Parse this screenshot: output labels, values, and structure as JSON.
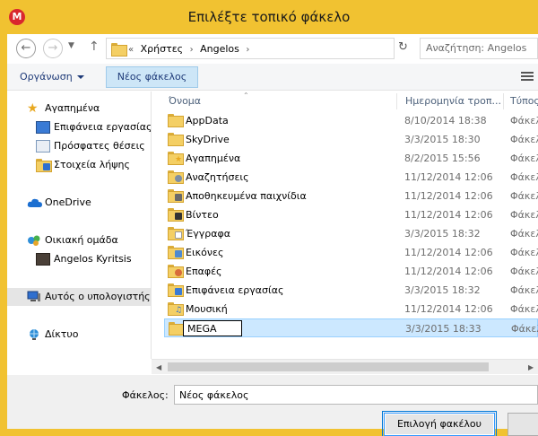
{
  "window": {
    "title": "Επιλέξτε τοπικό φάκελο",
    "app_icon_letter": "M",
    "accent": "#f1c231"
  },
  "nav": {
    "back_icon": "back-arrow-icon",
    "forward_icon": "forward-arrow-icon",
    "breadcrumb_prefix": "«",
    "breadcrumbs": [
      "Χρήστες",
      "Angelos"
    ],
    "search_placeholder": "Αναζήτηση: Angelos"
  },
  "toolbar": {
    "organize_label": "Οργάνωση",
    "new_folder_label": "Νέος φάκελος"
  },
  "sidebar": {
    "items": [
      {
        "label": "Αγαπημένα",
        "icon": "star-icon"
      },
      {
        "label": "Επιφάνεια εργασίας",
        "icon": "desktop-icon"
      },
      {
        "label": "Πρόσφατες θέσεις",
        "icon": "recent-places-icon"
      },
      {
        "label": "Στοιχεία λήψης",
        "icon": "downloads-icon"
      },
      {
        "label": "OneDrive",
        "icon": "cloud-icon"
      },
      {
        "label": "Οικιακή ομάδα",
        "icon": "homegroup-icon"
      },
      {
        "label": "Angelos Kyritsis",
        "icon": "user-avatar-icon"
      },
      {
        "label": "Αυτός ο υπολογιστής",
        "icon": "computer-icon"
      },
      {
        "label": "Δίκτυο",
        "icon": "network-icon"
      }
    ]
  },
  "columns": {
    "name": "Όνομα",
    "date": "Ημερομηνία τροπ...",
    "type": "Τύπος"
  },
  "files": [
    {
      "name": "AppData",
      "date": "8/10/2014 18:38",
      "type": "Φάκελ"
    },
    {
      "name": "SkyDrive",
      "date": "3/3/2015 18:30",
      "type": "Φάκελ"
    },
    {
      "name": "Αγαπημένα",
      "date": "8/2/2015 15:56",
      "type": "Φάκελ"
    },
    {
      "name": "Αναζητήσεις",
      "date": "11/12/2014 12:06",
      "type": "Φάκελ"
    },
    {
      "name": "Αποθηκευμένα παιχνίδια",
      "date": "11/12/2014 12:06",
      "type": "Φάκελ"
    },
    {
      "name": "Βίντεο",
      "date": "11/12/2014 12:06",
      "type": "Φάκελ"
    },
    {
      "name": "Έγγραφα",
      "date": "3/3/2015 18:32",
      "type": "Φάκελ"
    },
    {
      "name": "Εικόνες",
      "date": "11/12/2014 12:06",
      "type": "Φάκελ"
    },
    {
      "name": "Επαφές",
      "date": "11/12/2014 12:06",
      "type": "Φάκελ"
    },
    {
      "name": "Επιφάνεια εργασίας",
      "date": "3/3/2015 18:32",
      "type": "Φάκελ"
    },
    {
      "name": "Μουσική",
      "date": "11/12/2014 12:06",
      "type": "Φάκελ"
    },
    {
      "name": "MEGA",
      "date": "3/3/2015 18:33",
      "type": "Φάκελ"
    }
  ],
  "bottom": {
    "folder_label": "Φάκελος:",
    "folder_value": "Νέος φάκελος",
    "select_button": "Επιλογή φακέλου"
  }
}
